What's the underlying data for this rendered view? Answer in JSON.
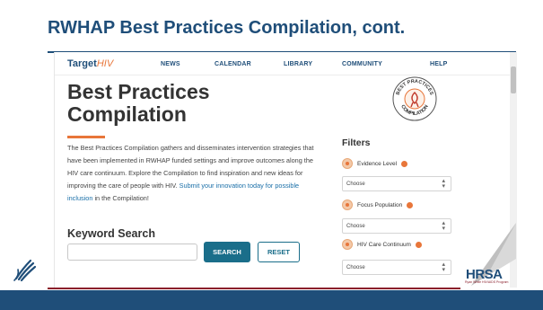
{
  "slide": {
    "title": "RWHAP Best Practices Compilation, cont."
  },
  "site": {
    "logo_main": "Target",
    "logo_accent": "HIV",
    "nav": [
      "NEWS",
      "CALENDAR",
      "LIBRARY",
      "COMMUNITY",
      "HELP"
    ]
  },
  "page": {
    "title": "Best Practices Compilation",
    "description_text": "The Best Practices Compilation gathers and disseminates intervention strategies that have been implemented in RWHAP funded settings and improve outcomes along the HIV care continuum. Explore the Compilation to find inspiration and new ideas for improving the care of people with HIV.",
    "description_link": "Submit your innovation today for possible inclusion",
    "description_tail": "in the Compilation!",
    "badge_top": "BEST PRACTICES",
    "badge_bottom": "COMPILATION"
  },
  "search": {
    "title": "Keyword Search",
    "placeholder": "",
    "search_label": "SEARCH",
    "reset_label": "RESET"
  },
  "filters": {
    "title": "Filters",
    "items": [
      {
        "label": "Evidence Level",
        "value": "Choose"
      },
      {
        "label": "Focus Population",
        "value": "Choose"
      },
      {
        "label": "HIV Care Continuum",
        "value": "Choose"
      }
    ]
  },
  "branding": {
    "hrsa": "HRSA",
    "hrsa_sub": "Ryan White HIV/AIDS Program"
  },
  "colors": {
    "navy": "#1f4e79",
    "accent_orange": "#e8763a",
    "maroon": "#8a1f2b",
    "button_teal": "#1a6e8a"
  }
}
